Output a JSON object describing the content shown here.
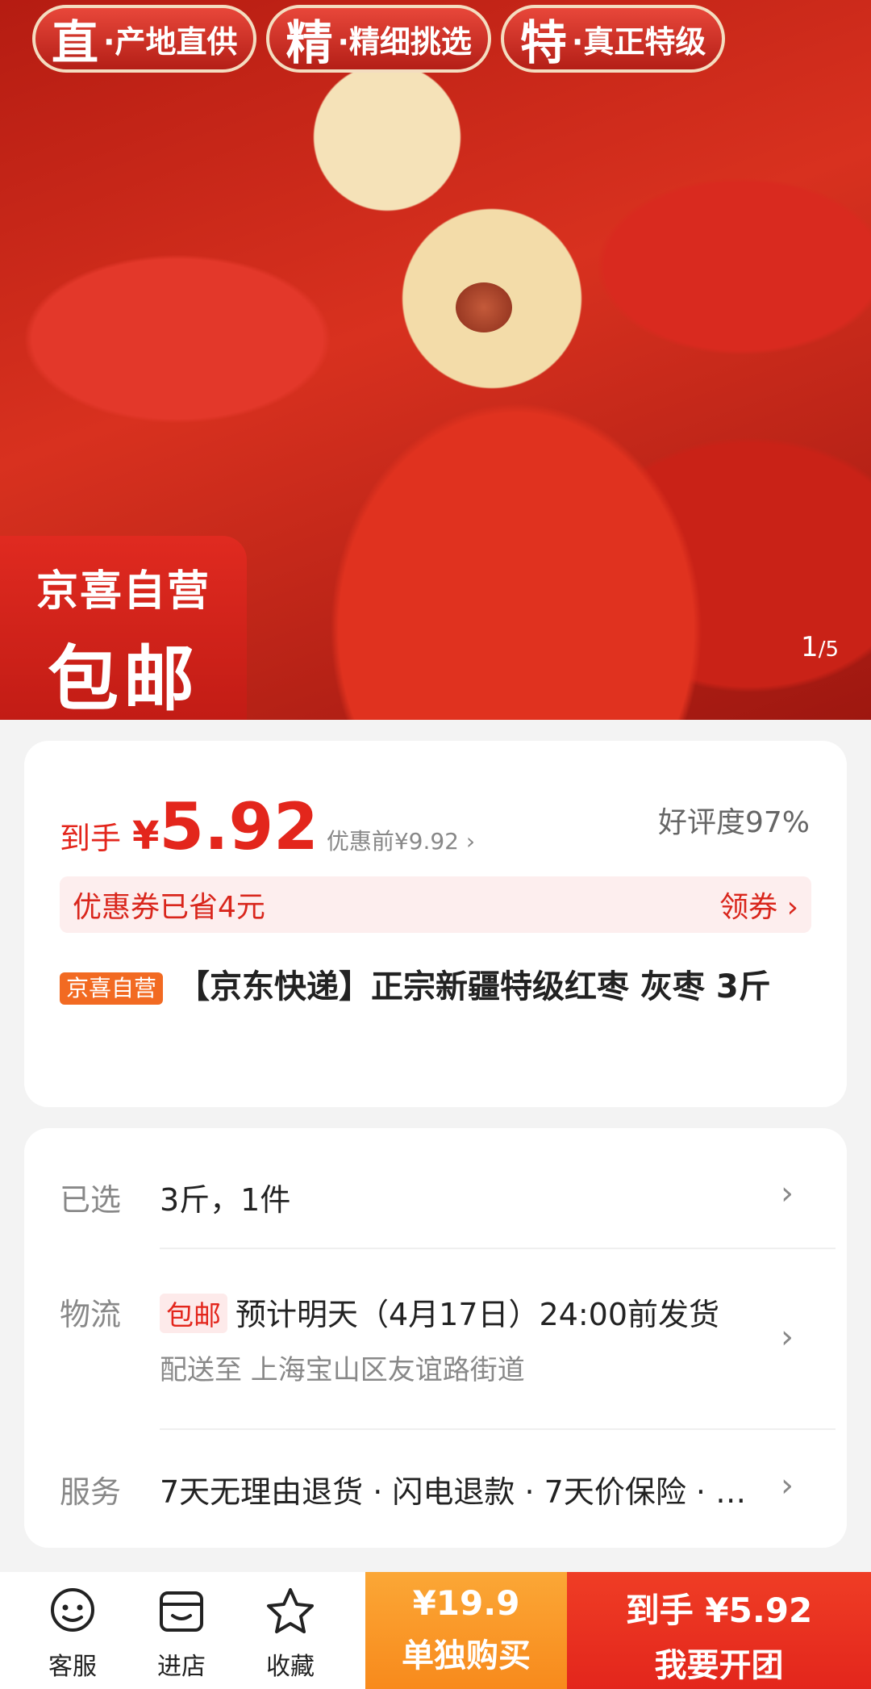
{
  "hero": {
    "tags": [
      {
        "big": "直",
        "small": "·产地直供"
      },
      {
        "big": "精",
        "small": "·精细挑选"
      },
      {
        "big": "特",
        "small": "·真正特级"
      }
    ],
    "badge_line1": "京喜自营",
    "badge_line2": "包邮",
    "pager_current": "1",
    "pager_total": "/5"
  },
  "price_card": {
    "daoshou_label": "到手",
    "currency": "¥",
    "price": "5.92",
    "before_label": "优惠前¥9.92 ›",
    "rating": "好评度97%",
    "coupon_text": "优惠券已省4元",
    "coupon_action": "领券 ›",
    "self_tag": "京喜自营",
    "title": "【京东快递】正宗新疆特级红枣 灰枣 3斤"
  },
  "details": {
    "selected_label": "已选",
    "selected_value": "3斤，1件",
    "logistics_label": "物流",
    "free_shipping_tag": "包邮",
    "logistics_value": "预计明天（4月17日）24:00前发货",
    "delivery_to": "配送至  上海宝山区友谊路街道",
    "service_label": "服务",
    "service_value": "7天无理由退货 · 闪电退款 · 7天价保险 · …",
    "chevron": "›"
  },
  "bottom_bar": {
    "service_label": "客服",
    "store_label": "进店",
    "favorite_label": "收藏",
    "alone_price": "¥19.9",
    "alone_label": "单独购买",
    "group_price": "到手 ¥5.92",
    "group_label": "我要开团"
  },
  "colors": {
    "accent_red": "#e3261c",
    "orange": "#f88a1c"
  }
}
